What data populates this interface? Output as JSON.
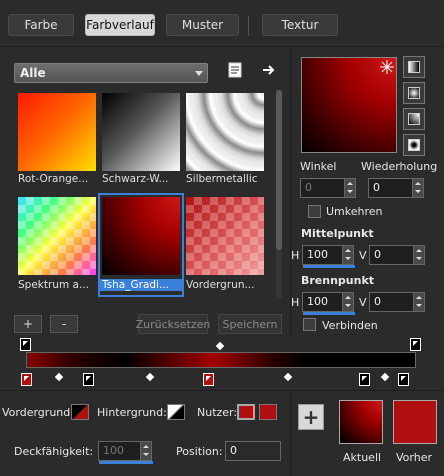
{
  "tabs": [
    "Farbe",
    "Farbverlauf",
    "Muster",
    "Textur"
  ],
  "active_tab": "Farbverlauf",
  "category": "Alle",
  "gallery": [
    {
      "label": "Rot-Orange..."
    },
    {
      "label": "Schwarz-W..."
    },
    {
      "label": "Silbermetallic"
    },
    {
      "label": "Spektrum a..."
    },
    {
      "label": "Tsha_Gradi..."
    },
    {
      "label": "Vordergrun..."
    }
  ],
  "selected_gradient": "Tsha_Gradi...",
  "buttons": {
    "add": "+",
    "remove": "-",
    "reset": "Zurücksetzen",
    "save": "Speichern"
  },
  "angle": {
    "label": "Winkel",
    "value": "0"
  },
  "repeat": {
    "label": "Wiederholung",
    "value": "0"
  },
  "invert": {
    "label": "Umkehren",
    "checked": false
  },
  "midpoint": {
    "label": "Mittelpunkt",
    "h_label": "H",
    "h_value": "100",
    "v_label": "V",
    "v_value": "0"
  },
  "focal": {
    "label": "Brennpunkt",
    "h_label": "H",
    "h_value": "100",
    "v_label": "V",
    "v_value": "0"
  },
  "link": {
    "label": "Verbinden",
    "checked": false
  },
  "bottom": {
    "foreground_label": "Vordergrund:",
    "background_label": "Hintergrund:",
    "user_label": "Nutzer:",
    "opacity_label": "Deckfähigkeit:",
    "opacity_value": "100",
    "position_label": "Position:",
    "position_value": "0",
    "current_label": "Aktuell",
    "previous_label": "Vorher"
  },
  "colors": {
    "accent": "#3c7fd8",
    "dark_red": "#a30000",
    "red": "#b01010"
  },
  "icons": [
    "document-icon",
    "arrow-right-icon",
    "plus-icon",
    "gradient-type-linear-icon",
    "gradient-type-radial-icon",
    "gradient-type-rectangular-icon",
    "gradient-type-sunburst-icon"
  ]
}
